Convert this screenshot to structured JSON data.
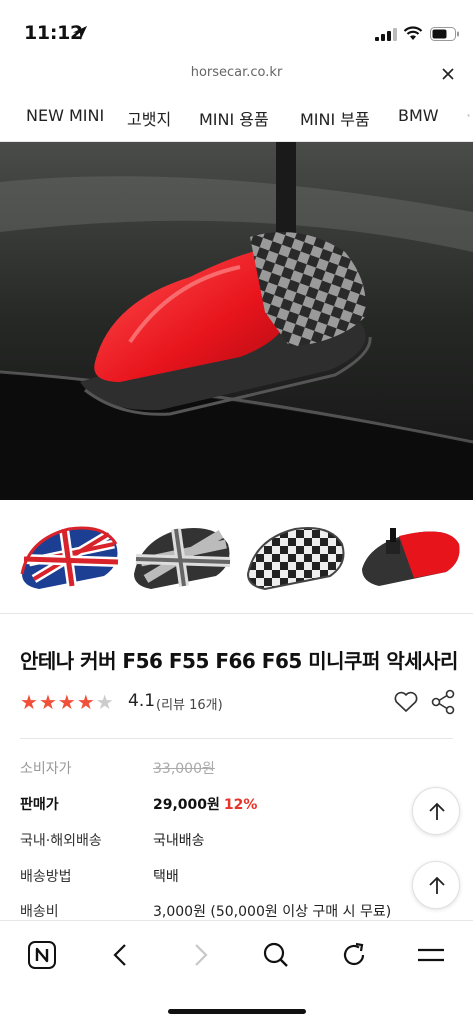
{
  "status_bar": {
    "time": "11:12"
  },
  "browser": {
    "url": "horsecar.co.kr"
  },
  "categories": [
    "NEW MINI",
    "고뱃지",
    "MINI 용품",
    "MINI 부품",
    "BMW"
  ],
  "product": {
    "title": "안테나 커버 F56 F55 F66 F65 미니쿠퍼 악세사리",
    "rating": "4.1",
    "rating_stars": 4,
    "review_count": "(리뷰 16개)"
  },
  "info": {
    "consumer_price_label": "소비자가",
    "consumer_price": "33,000원",
    "sale_price_label": "판매가",
    "sale_price": "29,000원",
    "discount": "12%",
    "shipping_region_label": "국내·해외배송",
    "shipping_region": "국내배송",
    "shipping_method_label": "배송방법",
    "shipping_method": "택배",
    "shipping_fee_label": "배송비",
    "shipping_fee": "3,000원 (50,000원 이상 구매 시 무료)"
  },
  "colors": {
    "accent": "#e8322a",
    "star": "#f0503a"
  }
}
